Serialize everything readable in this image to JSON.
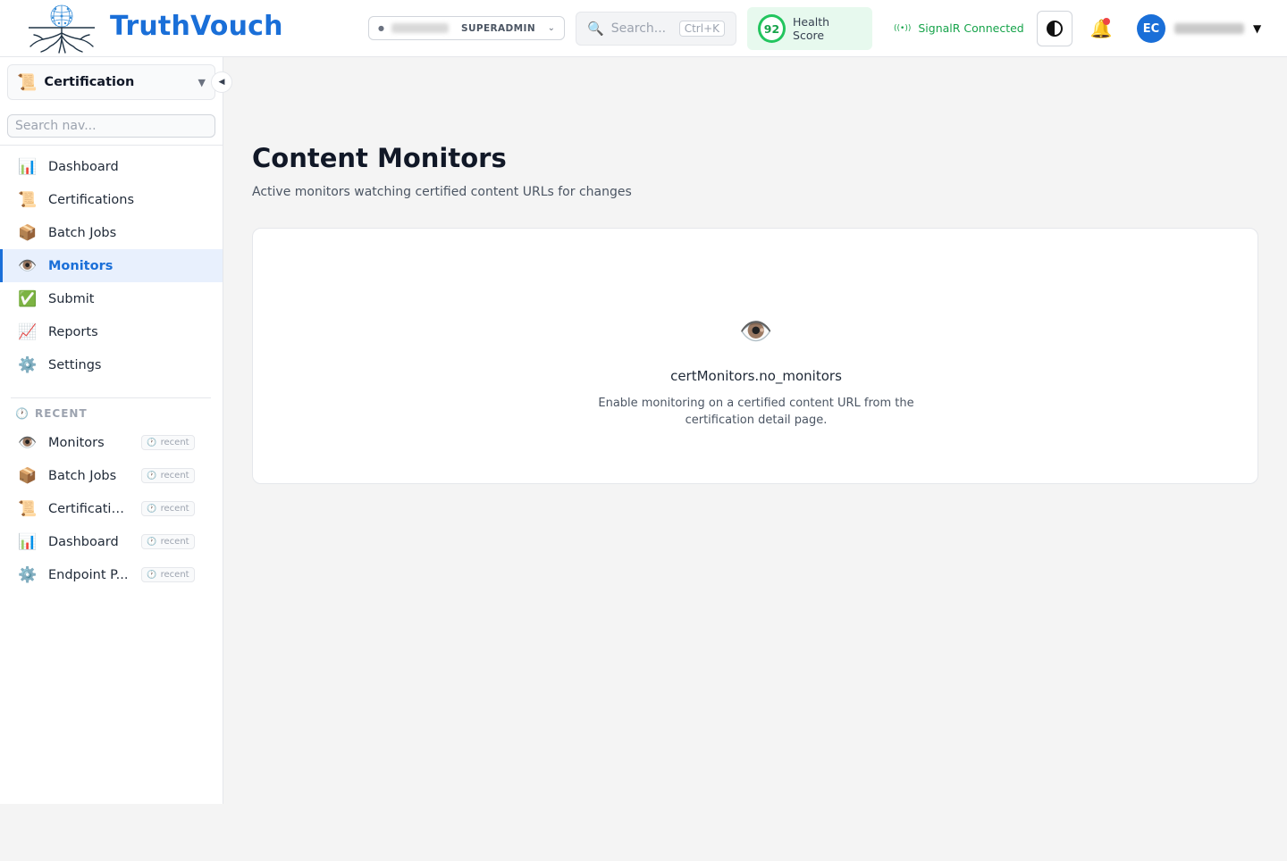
{
  "brand": {
    "name": "TruthVouch"
  },
  "header": {
    "tenant": {
      "role": "SUPERADMIN"
    },
    "search": {
      "placeholder": "Search...",
      "shortcut": "Ctrl+K"
    },
    "health": {
      "score": "92",
      "label": "Health Score"
    },
    "connection": {
      "status": "SignalR Connected"
    },
    "user": {
      "initials": "EC"
    },
    "colors": {
      "brand": "#1a6fd8",
      "health": "#22c55e",
      "connected": "#16a34a",
      "notification_dot": "#ef4444"
    }
  },
  "sidebar": {
    "module": {
      "icon": "📜",
      "label": "Certification"
    },
    "search_placeholder": "Search nav...",
    "items": [
      {
        "icon": "📊",
        "label": "Dashboard"
      },
      {
        "icon": "📜",
        "label": "Certifications"
      },
      {
        "icon": "📦",
        "label": "Batch Jobs"
      },
      {
        "icon": "👁️",
        "label": "Monitors",
        "active": true
      },
      {
        "icon": "✅",
        "label": "Submit"
      },
      {
        "icon": "📈",
        "label": "Reports"
      },
      {
        "icon": "⚙️",
        "label": "Settings"
      }
    ],
    "recent": {
      "title": "RECENT",
      "badge": "recent",
      "items": [
        {
          "icon": "👁️",
          "label": "Monitors"
        },
        {
          "icon": "📦",
          "label": "Batch Jobs"
        },
        {
          "icon": "📜",
          "label": "Certifications"
        },
        {
          "icon": "📊",
          "label": "Dashboard"
        },
        {
          "icon": "⚙️",
          "label": "Endpoint P..."
        }
      ]
    }
  },
  "main": {
    "title": "Content Monitors",
    "subtitle": "Active monitors watching certified content URLs for changes",
    "empty_state": {
      "icon": "👁️",
      "title": "certMonitors.no_monitors",
      "description": "Enable monitoring on a certified content URL from the certification detail page."
    }
  }
}
